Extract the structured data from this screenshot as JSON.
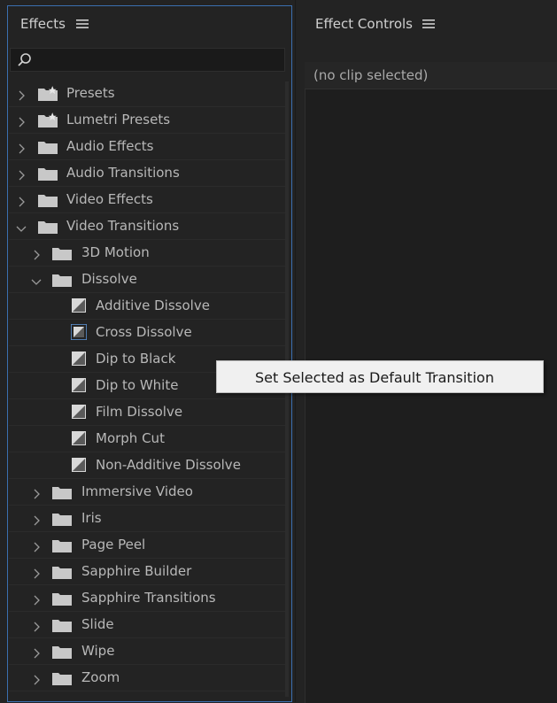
{
  "effects_panel": {
    "title": "Effects",
    "menu_icon": "hamburger-menu-icon",
    "search_icon": "search-icon",
    "search_value": ""
  },
  "effect_controls": {
    "title": "Effect Controls",
    "menu_icon": "hamburger-menu-icon",
    "no_clip_text": "(no clip selected)"
  },
  "tree": [
    {
      "label": "Presets",
      "level": 0,
      "type": "preset-folder",
      "expanded": false
    },
    {
      "label": "Lumetri Presets",
      "level": 0,
      "type": "preset-folder",
      "expanded": false
    },
    {
      "label": "Audio Effects",
      "level": 0,
      "type": "folder",
      "expanded": false
    },
    {
      "label": "Audio Transitions",
      "level": 0,
      "type": "folder",
      "expanded": false
    },
    {
      "label": "Video Effects",
      "level": 0,
      "type": "folder",
      "expanded": false
    },
    {
      "label": "Video Transitions",
      "level": 0,
      "type": "folder",
      "expanded": true
    },
    {
      "label": "3D Motion",
      "level": 1,
      "type": "folder",
      "expanded": false
    },
    {
      "label": "Dissolve",
      "level": 1,
      "type": "folder",
      "expanded": true
    },
    {
      "label": "Additive Dissolve",
      "level": 2,
      "type": "transition"
    },
    {
      "label": "Cross Dissolve",
      "level": 2,
      "type": "transition",
      "default": true
    },
    {
      "label": "Dip to Black",
      "level": 2,
      "type": "transition"
    },
    {
      "label": "Dip to White",
      "level": 2,
      "type": "transition"
    },
    {
      "label": "Film Dissolve",
      "level": 2,
      "type": "transition"
    },
    {
      "label": "Morph Cut",
      "level": 2,
      "type": "transition"
    },
    {
      "label": "Non-Additive Dissolve",
      "level": 2,
      "type": "transition"
    },
    {
      "label": "Immersive Video",
      "level": 1,
      "type": "folder",
      "expanded": false
    },
    {
      "label": "Iris",
      "level": 1,
      "type": "folder",
      "expanded": false
    },
    {
      "label": "Page Peel",
      "level": 1,
      "type": "folder",
      "expanded": false
    },
    {
      "label": "Sapphire Builder",
      "level": 1,
      "type": "folder",
      "expanded": false
    },
    {
      "label": "Sapphire Transitions",
      "level": 1,
      "type": "folder",
      "expanded": false
    },
    {
      "label": "Slide",
      "level": 1,
      "type": "folder",
      "expanded": false
    },
    {
      "label": "Wipe",
      "level": 1,
      "type": "folder",
      "expanded": false
    },
    {
      "label": "Zoom",
      "level": 1,
      "type": "folder",
      "expanded": false
    }
  ],
  "context_menu": {
    "items": [
      "Set Selected as Default Transition"
    ]
  },
  "colors": {
    "panel_bg": "#232323",
    "focus_border": "#3b6fb0",
    "text": "#b8b8b8",
    "menu_bg": "#f0f0f0"
  }
}
